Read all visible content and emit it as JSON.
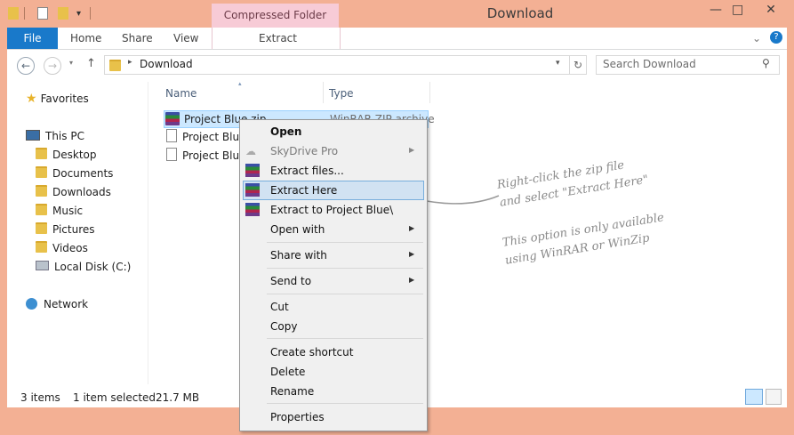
{
  "window": {
    "title": "Download",
    "contextual_tab_group": "Compressed Folder Tools",
    "minimize": "—",
    "maximize": "□",
    "close": "✕"
  },
  "ribbon": {
    "file": "File",
    "home": "Home",
    "share": "Share",
    "view": "View",
    "extract": "Extract",
    "collapse_chevron": "⌄"
  },
  "address": {
    "path_folder": "Download",
    "search_placeholder": "Search Download"
  },
  "nav": {
    "favorites": "Favorites",
    "this_pc": "This PC",
    "items": [
      "Desktop",
      "Documents",
      "Downloads",
      "Music",
      "Pictures",
      "Videos",
      "Local Disk (C:)"
    ],
    "network": "Network"
  },
  "columns": {
    "name": "Name",
    "type": "Type"
  },
  "files": [
    {
      "name": "Project Blue.zip",
      "type": "WinRAR ZIP archive",
      "selected": true
    },
    {
      "name": "Project Blue",
      "type": ""
    },
    {
      "name": "Project Blue",
      "type": ""
    }
  ],
  "context_menu": {
    "open": "Open",
    "skydrive": "SkyDrive Pro",
    "extract_files": "Extract files...",
    "extract_here": "Extract Here",
    "extract_to": "Extract to Project Blue\\",
    "open_with": "Open with",
    "share_with": "Share with",
    "send_to": "Send to",
    "cut": "Cut",
    "copy": "Copy",
    "create_shortcut": "Create shortcut",
    "delete": "Delete",
    "rename": "Rename",
    "properties": "Properties"
  },
  "annotations": {
    "line1": "Right-click the zip file",
    "line2": "and select \"Extract Here\"",
    "line3": "This option is only available",
    "line4": "using WinRAR or WinZip"
  },
  "status": {
    "items": "3 items",
    "selected": "1 item selected",
    "size": "21.7 MB"
  },
  "colors": {
    "titlebar": "#f3b094",
    "file_tab": "#1979ca",
    "contextual_tab": "#f7cbd6",
    "selection": "#cce8ff"
  }
}
